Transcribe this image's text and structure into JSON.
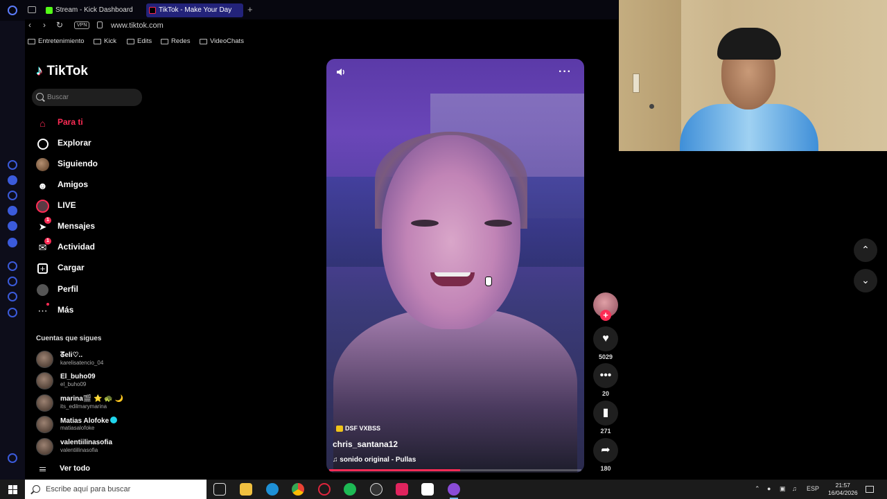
{
  "browser": {
    "tabs": [
      {
        "label": "Stream - Kick Dashboard",
        "favicon_color": "#53fc18"
      },
      {
        "label": "TikTok - Make Your Day",
        "favicon_color": "#111111"
      }
    ],
    "url": "www.tiktok.com",
    "vpn_label": "VPN",
    "bookmarks": [
      "Entretenimiento",
      "Kick",
      "Edits",
      "Redes",
      "VideoChats"
    ]
  },
  "tiktok": {
    "logo_text": "TikTok",
    "search_placeholder": "Buscar",
    "menu": [
      {
        "label": "Para ti",
        "icon": "home-icon"
      },
      {
        "label": "Explorar",
        "icon": "compass-icon"
      },
      {
        "label": "Siguiendo",
        "icon": "following-avatar-icon"
      },
      {
        "label": "Amigos",
        "icon": "friends-icon"
      },
      {
        "label": "LIVE",
        "icon": "live-icon"
      },
      {
        "label": "Mensajes",
        "icon": "messages-icon",
        "badge": "1"
      },
      {
        "label": "Actividad",
        "icon": "activity-icon",
        "badge": "1"
      },
      {
        "label": "Cargar",
        "icon": "upload-icon"
      },
      {
        "label": "Perfil",
        "icon": "profile-icon"
      },
      {
        "label": "Más",
        "icon": "more-icon"
      }
    ],
    "following_title": "Cuentas que sigues",
    "following": [
      {
        "name": "ᘔeli♡..",
        "username": "karelisatencio_04"
      },
      {
        "name": "El_buho09",
        "username": "el_buho09"
      },
      {
        "name": "marina🎬 ⭐ 🐢 🌙",
        "username": "its_edilmarymarina"
      },
      {
        "name": "Matias  Alofoke",
        "username": "matiasalofoke",
        "verified": true
      },
      {
        "name": "valentiilinasofia",
        "username": "valentiilinasofia"
      }
    ],
    "see_all": "Ver todo"
  },
  "video": {
    "tag": "DSF VXBSS",
    "author": "chris_santana12",
    "sound": "♫  sonido original - Pullas",
    "progress": 0.52,
    "likes": "5029",
    "comments": "20",
    "saves": "271",
    "shares": "180"
  },
  "taskbar": {
    "search_placeholder": "Escribe aquí para buscar",
    "language": "ESP",
    "time": "21:57",
    "date": "16/04/2026"
  },
  "colors": {
    "accent": "#fe2c55",
    "browser_rail": "#3b5bdb",
    "active_tab": "#23237a"
  }
}
